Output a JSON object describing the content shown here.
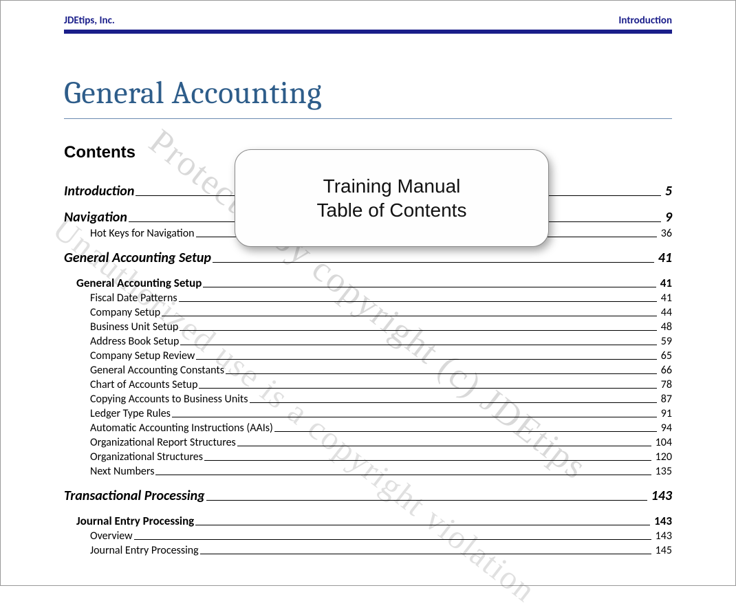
{
  "header": {
    "left": "JDEtips, Inc.",
    "right": "Introduction"
  },
  "title": "General Accounting",
  "contents_label": "Contents",
  "callout": {
    "line1": "Training Manual",
    "line2": "Table of Contents"
  },
  "watermark": {
    "line1": "Protected by copyright (c) JDEtips",
    "line2": "Unauthorized use is a copyright violation"
  },
  "toc": [
    {
      "level": 1,
      "label": "Introduction",
      "page": "5"
    },
    {
      "level": 1,
      "label": "Navigation",
      "page": "9"
    },
    {
      "level": 3,
      "label": "Hot Keys for Navigation",
      "page": "36"
    },
    {
      "level": 1,
      "label": "General Accounting Setup",
      "page": "41"
    },
    {
      "level": 2,
      "label": "General Accounting Setup",
      "page": "41"
    },
    {
      "level": 3,
      "label": "Fiscal Date Patterns",
      "page": "41"
    },
    {
      "level": 3,
      "label": "Company Setup",
      "page": "44"
    },
    {
      "level": 3,
      "label": "Business Unit Setup",
      "page": "48"
    },
    {
      "level": 3,
      "label": "Address Book Setup",
      "page": "59"
    },
    {
      "level": 3,
      "label": "Company Setup Review",
      "page": "65"
    },
    {
      "level": 3,
      "label": "General Accounting Constants",
      "page": "66"
    },
    {
      "level": 3,
      "label": "Chart of Accounts Setup",
      "page": "78"
    },
    {
      "level": 3,
      "label": "Copying Accounts to Business Units",
      "page": "87"
    },
    {
      "level": 3,
      "label": "Ledger Type Rules",
      "page": "91"
    },
    {
      "level": 3,
      "label": "Automatic Accounting Instructions (AAIs)",
      "page": "94"
    },
    {
      "level": 3,
      "label": "Organizational Report Structures",
      "page": "104"
    },
    {
      "level": 3,
      "label": "Organizational Structures",
      "page": "120"
    },
    {
      "level": 3,
      "label": "Next Numbers",
      "page": "135"
    },
    {
      "level": 1,
      "label": "Transactional Processing",
      "page": "143"
    },
    {
      "level": 2,
      "label": "Journal Entry Processing",
      "page": "143"
    },
    {
      "level": 3,
      "label": "Overview",
      "page": "143"
    },
    {
      "level": 3,
      "label": "Journal Entry Processing",
      "page": "145"
    }
  ]
}
